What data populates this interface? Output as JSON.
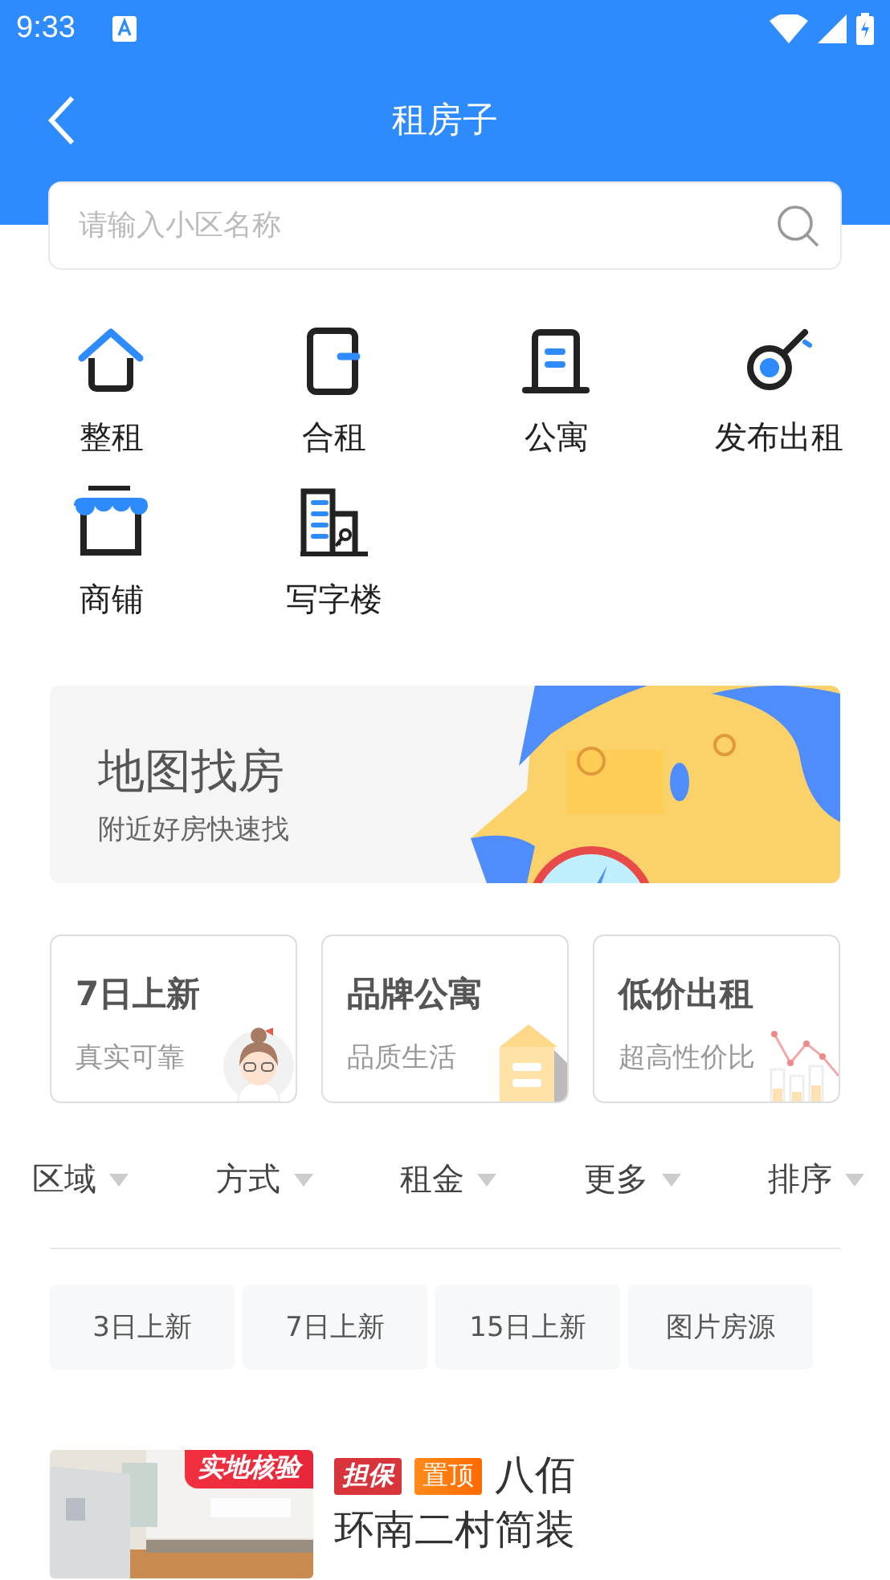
{
  "status_bar": {
    "time": "9:33"
  },
  "header": {
    "title": "租房子"
  },
  "search": {
    "placeholder": "请输入小区名称"
  },
  "categories": [
    {
      "label": "整租",
      "kind": "house"
    },
    {
      "label": "合租",
      "kind": "door"
    },
    {
      "label": "公寓",
      "kind": "apartment"
    },
    {
      "label": "发布出租",
      "kind": "key"
    },
    {
      "label": "商铺",
      "kind": "shop"
    },
    {
      "label": "写字楼",
      "kind": "office"
    }
  ],
  "map_banner": {
    "title": "地图找房",
    "subtitle": "附近好房快速找"
  },
  "feature_cards": [
    {
      "title": "7日上新",
      "subtitle": "真实可靠",
      "kind": "figure"
    },
    {
      "title": "品牌公寓",
      "subtitle": "品质生活",
      "kind": "building"
    },
    {
      "title": "低价出租",
      "subtitle": "超高性价比",
      "kind": "chart"
    }
  ],
  "filters": [
    {
      "label": "区域"
    },
    {
      "label": "方式"
    },
    {
      "label": "租金"
    },
    {
      "label": "更多"
    },
    {
      "label": "排序"
    }
  ],
  "tags": [
    {
      "label": "3日上新"
    },
    {
      "label": "7日上新"
    },
    {
      "label": "15日上新"
    },
    {
      "label": "图片房源"
    }
  ],
  "listings": [
    {
      "photo_badge": "实地核验",
      "badges": [
        {
          "label": "担保",
          "kind": "guarantee"
        },
        {
          "label": "置顶",
          "kind": "top"
        }
      ],
      "title_lines": [
        "八佰",
        "环南二村简装"
      ]
    }
  ]
}
